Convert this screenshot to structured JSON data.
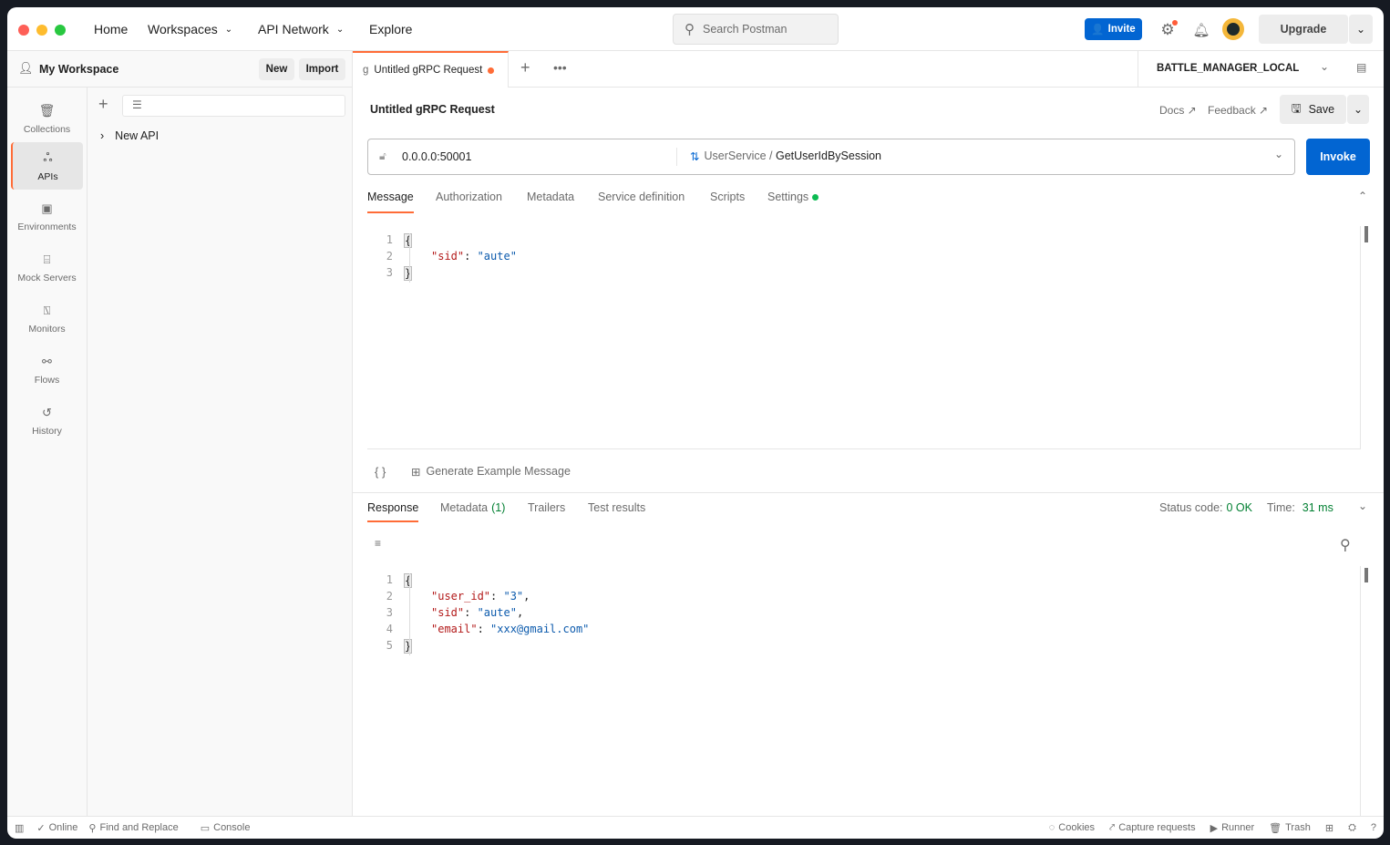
{
  "colors": {
    "accent": "#ff6c37",
    "primary": "#0265d2",
    "success": "#007f31"
  },
  "topbar": {
    "nav": [
      {
        "label": "Home"
      },
      {
        "label": "Workspaces"
      },
      {
        "label": "API Network"
      },
      {
        "label": "Explore"
      }
    ],
    "search_placeholder": "Search Postman",
    "invite": "Invite",
    "upgrade": "Upgrade"
  },
  "workspace": {
    "name": "My Workspace",
    "new": "New",
    "import": "Import"
  },
  "sidebar": {
    "items": [
      {
        "label": "Collections",
        "icon": "trash-can-icon"
      },
      {
        "label": "APIs",
        "icon": "apis-icon",
        "active": true
      },
      {
        "label": "Environments",
        "icon": "environment-icon"
      },
      {
        "label": "Mock Servers",
        "icon": "server-icon"
      },
      {
        "label": "Monitors",
        "icon": "monitor-icon"
      },
      {
        "label": "Flows",
        "icon": "flows-icon"
      },
      {
        "label": "History",
        "icon": "history-icon"
      }
    ]
  },
  "tree": {
    "items": [
      {
        "label": "New API"
      }
    ]
  },
  "tabs": [
    {
      "label": "Untitled gRPC Request",
      "unsaved": true
    }
  ],
  "environment": "BATTLE_MANAGER_LOCAL",
  "request": {
    "title": "Untitled gRPC Request",
    "docs": "Docs ↗",
    "feedback": "Feedback ↗",
    "save": "Save",
    "url": "0.0.0.0:50001",
    "service": "UserService",
    "separator": " / ",
    "method": "GetUserIdBySession",
    "invoke": "Invoke",
    "tabs": [
      {
        "label": "Message"
      },
      {
        "label": "Authorization"
      },
      {
        "label": "Metadata"
      },
      {
        "label": "Service definition"
      },
      {
        "label": "Scripts"
      },
      {
        "label": "Settings"
      }
    ],
    "message_lines": [
      {
        "n": "1",
        "t": "{"
      },
      {
        "n": "2",
        "k": "\"sid\"",
        "p": ": ",
        "v": "\"aute\""
      },
      {
        "n": "3",
        "t": "}"
      }
    ],
    "braces": "{ }",
    "generate": "Generate Example Message"
  },
  "response": {
    "tabs": [
      {
        "label": "Response"
      },
      {
        "label": "Metadata"
      },
      {
        "label": "Trailers"
      },
      {
        "label": "Test results"
      }
    ],
    "metadata_count": "(1)",
    "status_label": "Status code:",
    "status_value": "0 OK",
    "time_label": "Time:",
    "time_value": "31 ms",
    "lines": [
      {
        "n": "1",
        "t": "{"
      },
      {
        "n": "2",
        "k": "\"user_id\"",
        "p": ": ",
        "v": "\"3\"",
        "c": ","
      },
      {
        "n": "3",
        "k": "\"sid\"",
        "p": ": ",
        "v": "\"aute\"",
        "c": ","
      },
      {
        "n": "4",
        "k": "\"email\"",
        "p": ": ",
        "v": "\"xxx@gmail.com\""
      },
      {
        "n": "5",
        "t": "}"
      }
    ]
  },
  "statusbar": {
    "online": "Online",
    "find": "Find and Replace",
    "console": "Console",
    "cookies": "Cookies",
    "capture": "Capture requests",
    "runner": "Runner",
    "trash": "Trash"
  }
}
